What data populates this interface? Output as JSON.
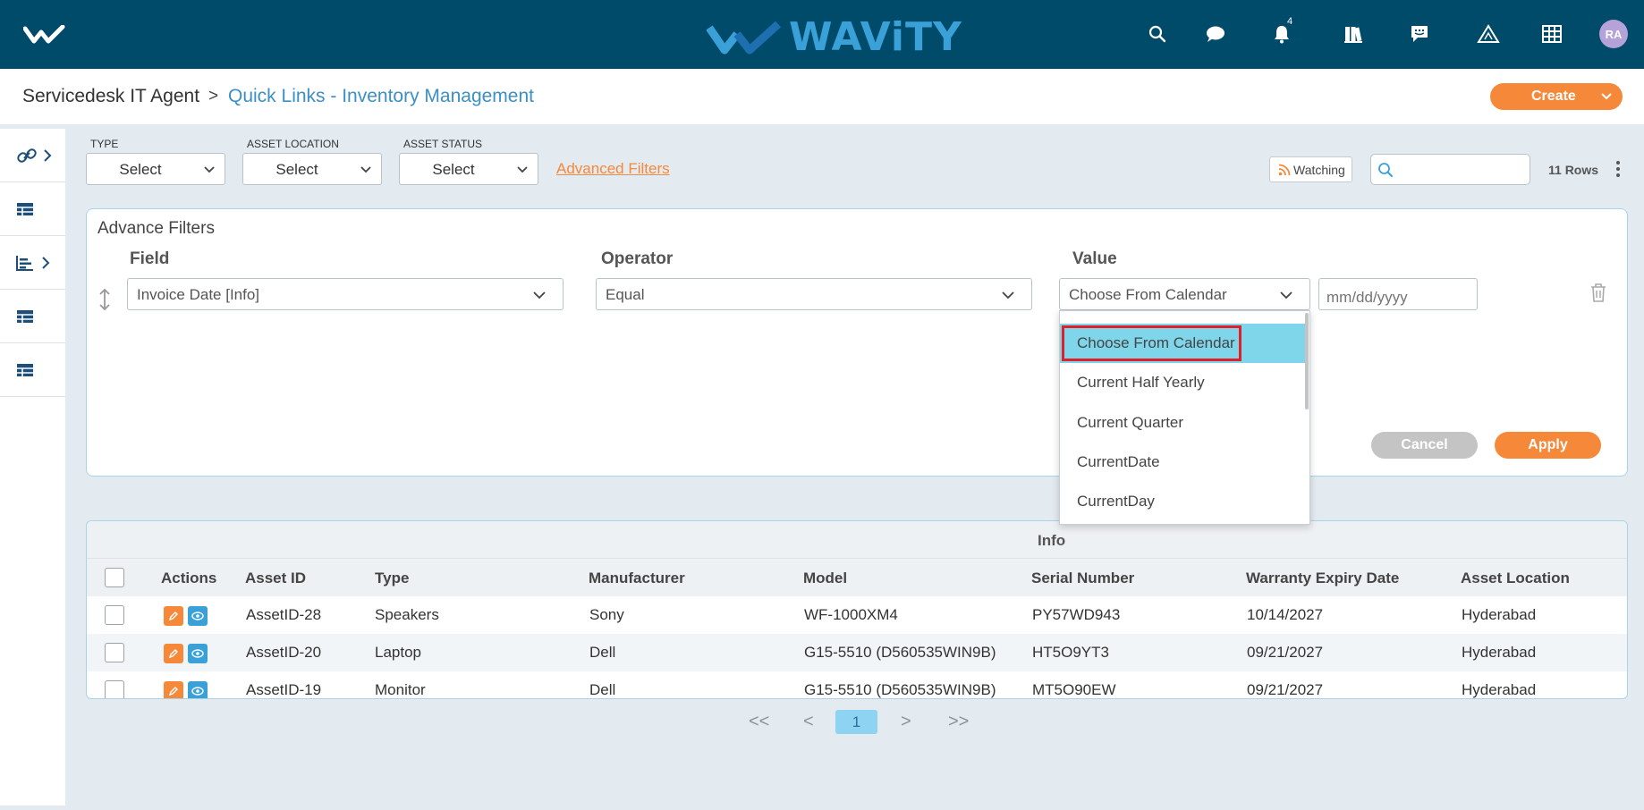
{
  "header": {
    "brand": "WAViTY",
    "notification_count": "4",
    "avatar_initials": "RA",
    "icons": [
      "search-icon",
      "chat-icon",
      "bell-icon",
      "library-icon",
      "message-icon",
      "alert-triangle-icon",
      "grid-icon"
    ]
  },
  "breadcrumb": {
    "root": "Servicedesk IT Agent",
    "separator": ">",
    "current": "Quick Links - Inventory Management"
  },
  "create_button": "Create",
  "filters": {
    "type_label": "TYPE",
    "type_value": "Select",
    "location_label": "ASSET LOCATION",
    "location_value": "Select",
    "status_label": "ASSET STATUS",
    "status_value": "Select",
    "advanced_link": "Advanced Filters",
    "watching": "Watching",
    "search_value": "",
    "rows_count": "11 Rows"
  },
  "advance_filters": {
    "title": "Advance Filters",
    "field_header": "Field",
    "operator_header": "Operator",
    "value_header": "Value",
    "field_value": "Invoice Date [Info]",
    "operator_value": "Equal",
    "value_value": "Choose From Calendar",
    "date_placeholder": "mm/dd/yyyy",
    "cancel": "Cancel",
    "apply": "Apply",
    "value_options": [
      "Choose From Calendar",
      "Current Half Yearly",
      "Current Quarter",
      "CurrentDate",
      "CurrentDay"
    ]
  },
  "table": {
    "group_header": "Info",
    "columns": [
      "Actions",
      "Asset ID",
      "Type",
      "Manufacturer",
      "Model",
      "Serial Number",
      "Warranty Expiry Date",
      "Asset Location"
    ],
    "rows": [
      [
        "AssetID-28",
        "Speakers",
        "Sony",
        "WF-1000XM4",
        "PY57WD943",
        "10/14/2027",
        "Hyderabad"
      ],
      [
        "AssetID-20",
        "Laptop",
        "Dell",
        "G15-5510 (D560535WIN9B)",
        "HT5O9YT3",
        "09/21/2027",
        "Hyderabad"
      ],
      [
        "AssetID-19",
        "Monitor",
        "Dell",
        "G15-5510 (D560535WIN9B)",
        "MT5O90EW",
        "09/21/2027",
        "Hyderabad"
      ]
    ]
  },
  "pagination": {
    "first": "<<",
    "prev": "<",
    "current": "1",
    "next": ">",
    "last": ">>"
  },
  "colors": {
    "nav": "#004a6a",
    "accent_orange": "#f6883a",
    "accent_blue": "#3aa0d8",
    "selected_option": "#7fd5ea",
    "highlight_border": "#e01f26"
  }
}
